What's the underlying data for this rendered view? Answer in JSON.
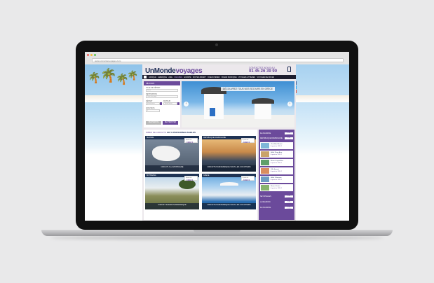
{
  "browser": {
    "url": "www.unmondevoyages.com"
  },
  "site": {
    "logo_a": "UnMonde",
    "logo_b": "voyages",
    "contact_label": "CONTACTEZ-NOUS AU",
    "phone": "01 45 26 39 90"
  },
  "nav": {
    "items": [
      "AFRIQUE",
      "AMERIQUE",
      "ASIE",
      "CARAIBES",
      "EUROPE",
      "MOYEN-ORIENT",
      "OCEAN INDIEN",
      "OCEAN PACIFIQUE",
      "VOYAGES A THEMES",
      "VOYAGES DE NOCES"
    ]
  },
  "search": {
    "tab": "SÉJOURS",
    "departure_label": "VILLE DE DÉPART",
    "departure_value": "Paris",
    "destination_label": "DESTINATION",
    "destination_value": "Tous les pays",
    "depart_label": "DÉPART",
    "return_label": "RETOUR",
    "date_value": "jj/mm/aaaa",
    "adults_label": "ADULTE(S)",
    "adults_value": "2",
    "more_label": "RECHERCHE AVANCÉE",
    "submit_label": "RECHERCHER"
  },
  "hero": {
    "caption": "DÉCOUVREZ TOUS NOS SÉJOURS EN GRÈCE",
    "prev": "‹",
    "next": "›"
  },
  "circuits": {
    "title_a": "IDÉES DE CIRCUITS ",
    "title_b": "100 % PERSONNALISABLES",
    "cards": [
      {
        "country": "ISLANDE",
        "price_label": "À partir de",
        "price": "1992 €",
        "caption": "CIRCUIT A LA MONTAGNE"
      },
      {
        "country": "REPUBLIQUE DOMINICAINE",
        "price_label": "À partir de",
        "price": "1992 €",
        "caption": "CIRCUITS PANORAMIQUE SOUS LES COCOTIERS"
      },
      {
        "country": "BOTSWANA",
        "price_label": "À partir de",
        "price": "1992 €",
        "caption": "CIRCUIT SAFARI PANORAMIQUE"
      },
      {
        "country": "GRECE",
        "price_label": "À partir de",
        "price": "1992 €",
        "caption": "CIRCUITS PANORAMIQUE SOUS LES COCOTIERS"
      }
    ]
  },
  "sidebar": {
    "rows": [
      {
        "label": "ILE MAURICE",
        "dates": "VOIR OFFRES"
      },
      {
        "label": "REPUBLIQUE DOMINICAINE",
        "dates": "VOIR OFFRES"
      }
    ],
    "offers": [
      {
        "name": "Club Med Resort",
        "price": "À partir de 1990 €"
      },
      {
        "name": "Hôtel Plage Azur",
        "price": "À partir de 1990 €"
      },
      {
        "name": "Resort Lagon Bleu",
        "price": "À partir de 1990 €"
      },
      {
        "name": "Villa Sunset",
        "price": "À partir de 1990 €"
      },
      {
        "name": "Hôtel Palmeraie",
        "price": "À partir de 1990 €"
      },
      {
        "name": "Resort Océan",
        "price": "À partir de 1990 €"
      }
    ],
    "bottom_rows": [
      {
        "label": "SEYCHELLES",
        "dates": "VOIR OFFRES"
      },
      {
        "label": "LA REUNION",
        "dates": "VOIR OFFRES"
      },
      {
        "label": "ILE MAURICE",
        "dates": "VOIR OFFRES"
      }
    ]
  },
  "social": {
    "facebook": "f",
    "twitter": "t",
    "google": "g"
  }
}
